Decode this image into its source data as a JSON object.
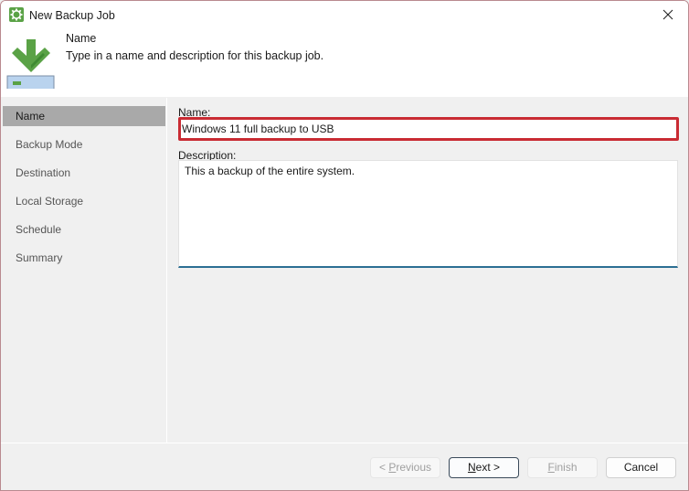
{
  "window": {
    "title": "New Backup Job"
  },
  "header": {
    "step_title": "Name",
    "step_description": "Type in a name and description for this backup job."
  },
  "sidebar": {
    "items": [
      {
        "label": "Name",
        "active": true
      },
      {
        "label": "Backup Mode",
        "active": false
      },
      {
        "label": "Destination",
        "active": false
      },
      {
        "label": "Local Storage",
        "active": false
      },
      {
        "label": "Schedule",
        "active": false
      },
      {
        "label": "Summary",
        "active": false
      }
    ]
  },
  "form": {
    "name_label": "Name:",
    "name_value": "Windows 11 full backup to USB",
    "description_label_accel": "D",
    "description_label_rest": "escription:",
    "description_value": "This a backup of the entire system."
  },
  "footer": {
    "previous_prefix": "< ",
    "previous_accel": "P",
    "previous_rest": "revious",
    "next_accel": "N",
    "next_rest": "ext >",
    "finish_accel": "F",
    "finish_rest": "inish",
    "cancel_label": "Cancel"
  },
  "colors": {
    "highlight_border": "#c92b33",
    "accent_green": "#5aa246",
    "focus_underline": "#2c6f93"
  }
}
